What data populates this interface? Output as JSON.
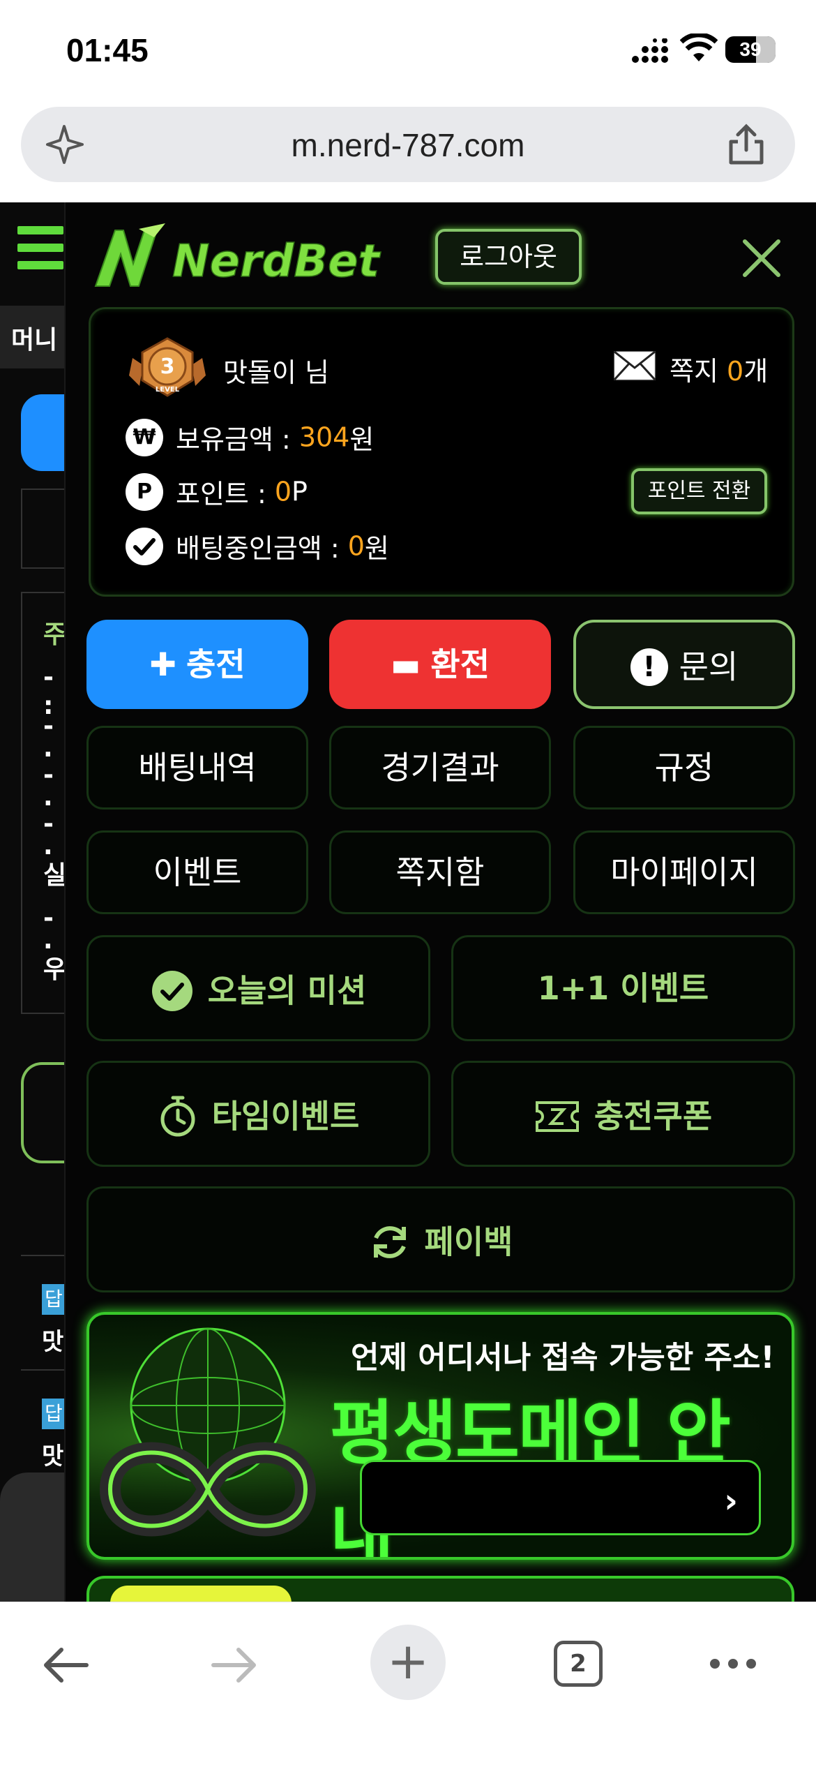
{
  "status_bar": {
    "time": "01:45",
    "battery": "39"
  },
  "browser": {
    "url": "m.nerd-787.com",
    "tab_count": "2"
  },
  "background_page": {
    "tab_label": "머니",
    "box_lines": [
      "주",
      "- :",
      "- ·",
      "- ·",
      "- ·",
      "실",
      "- ·",
      "우"
    ],
    "items": [
      {
        "tag": "답",
        "text": "맛"
      },
      {
        "tag": "답",
        "text": "맛"
      }
    ]
  },
  "menu": {
    "logo_text": "NerdBet",
    "logout_label": "로그아웃",
    "user": {
      "level": "3",
      "level_caption": "LEVEL",
      "nickname": "맛돌이 님",
      "notes_label": "쪽지",
      "notes_count": "0",
      "notes_unit": "개",
      "balance_label": "보유금액 : ",
      "balance_value": "304",
      "balance_unit": "원",
      "point_label": "포인트 : ",
      "point_value": "0",
      "point_unit": "P",
      "betting_label": "배팅중인금액 : ",
      "betting_value": "0",
      "betting_unit": "원",
      "point_convert_label": "포인트 전환",
      "won_symbol": "₩",
      "point_symbol": "P"
    },
    "actions": {
      "charge": "충전",
      "exchange": "환전",
      "inquiry": "문의"
    },
    "grid": [
      "배팅내역",
      "경기결과",
      "규정",
      "이벤트",
      "쪽지함",
      "마이페이지"
    ],
    "promo": {
      "mission": "오늘의 미션",
      "one_plus_one": "1+1 이벤트",
      "time_event": "타임이벤트",
      "coupon": "충전쿠폰",
      "payback": "페이백"
    },
    "banner": {
      "subtitle": "언제 어디서나 접속 가능한 주소!",
      "title": "평생도메인 안내"
    }
  },
  "colors": {
    "accent_green": "#8bc46f",
    "charge_blue": "#1e90ff",
    "exchange_red": "#ee3232",
    "highlight_orange": "#ffa51e"
  }
}
